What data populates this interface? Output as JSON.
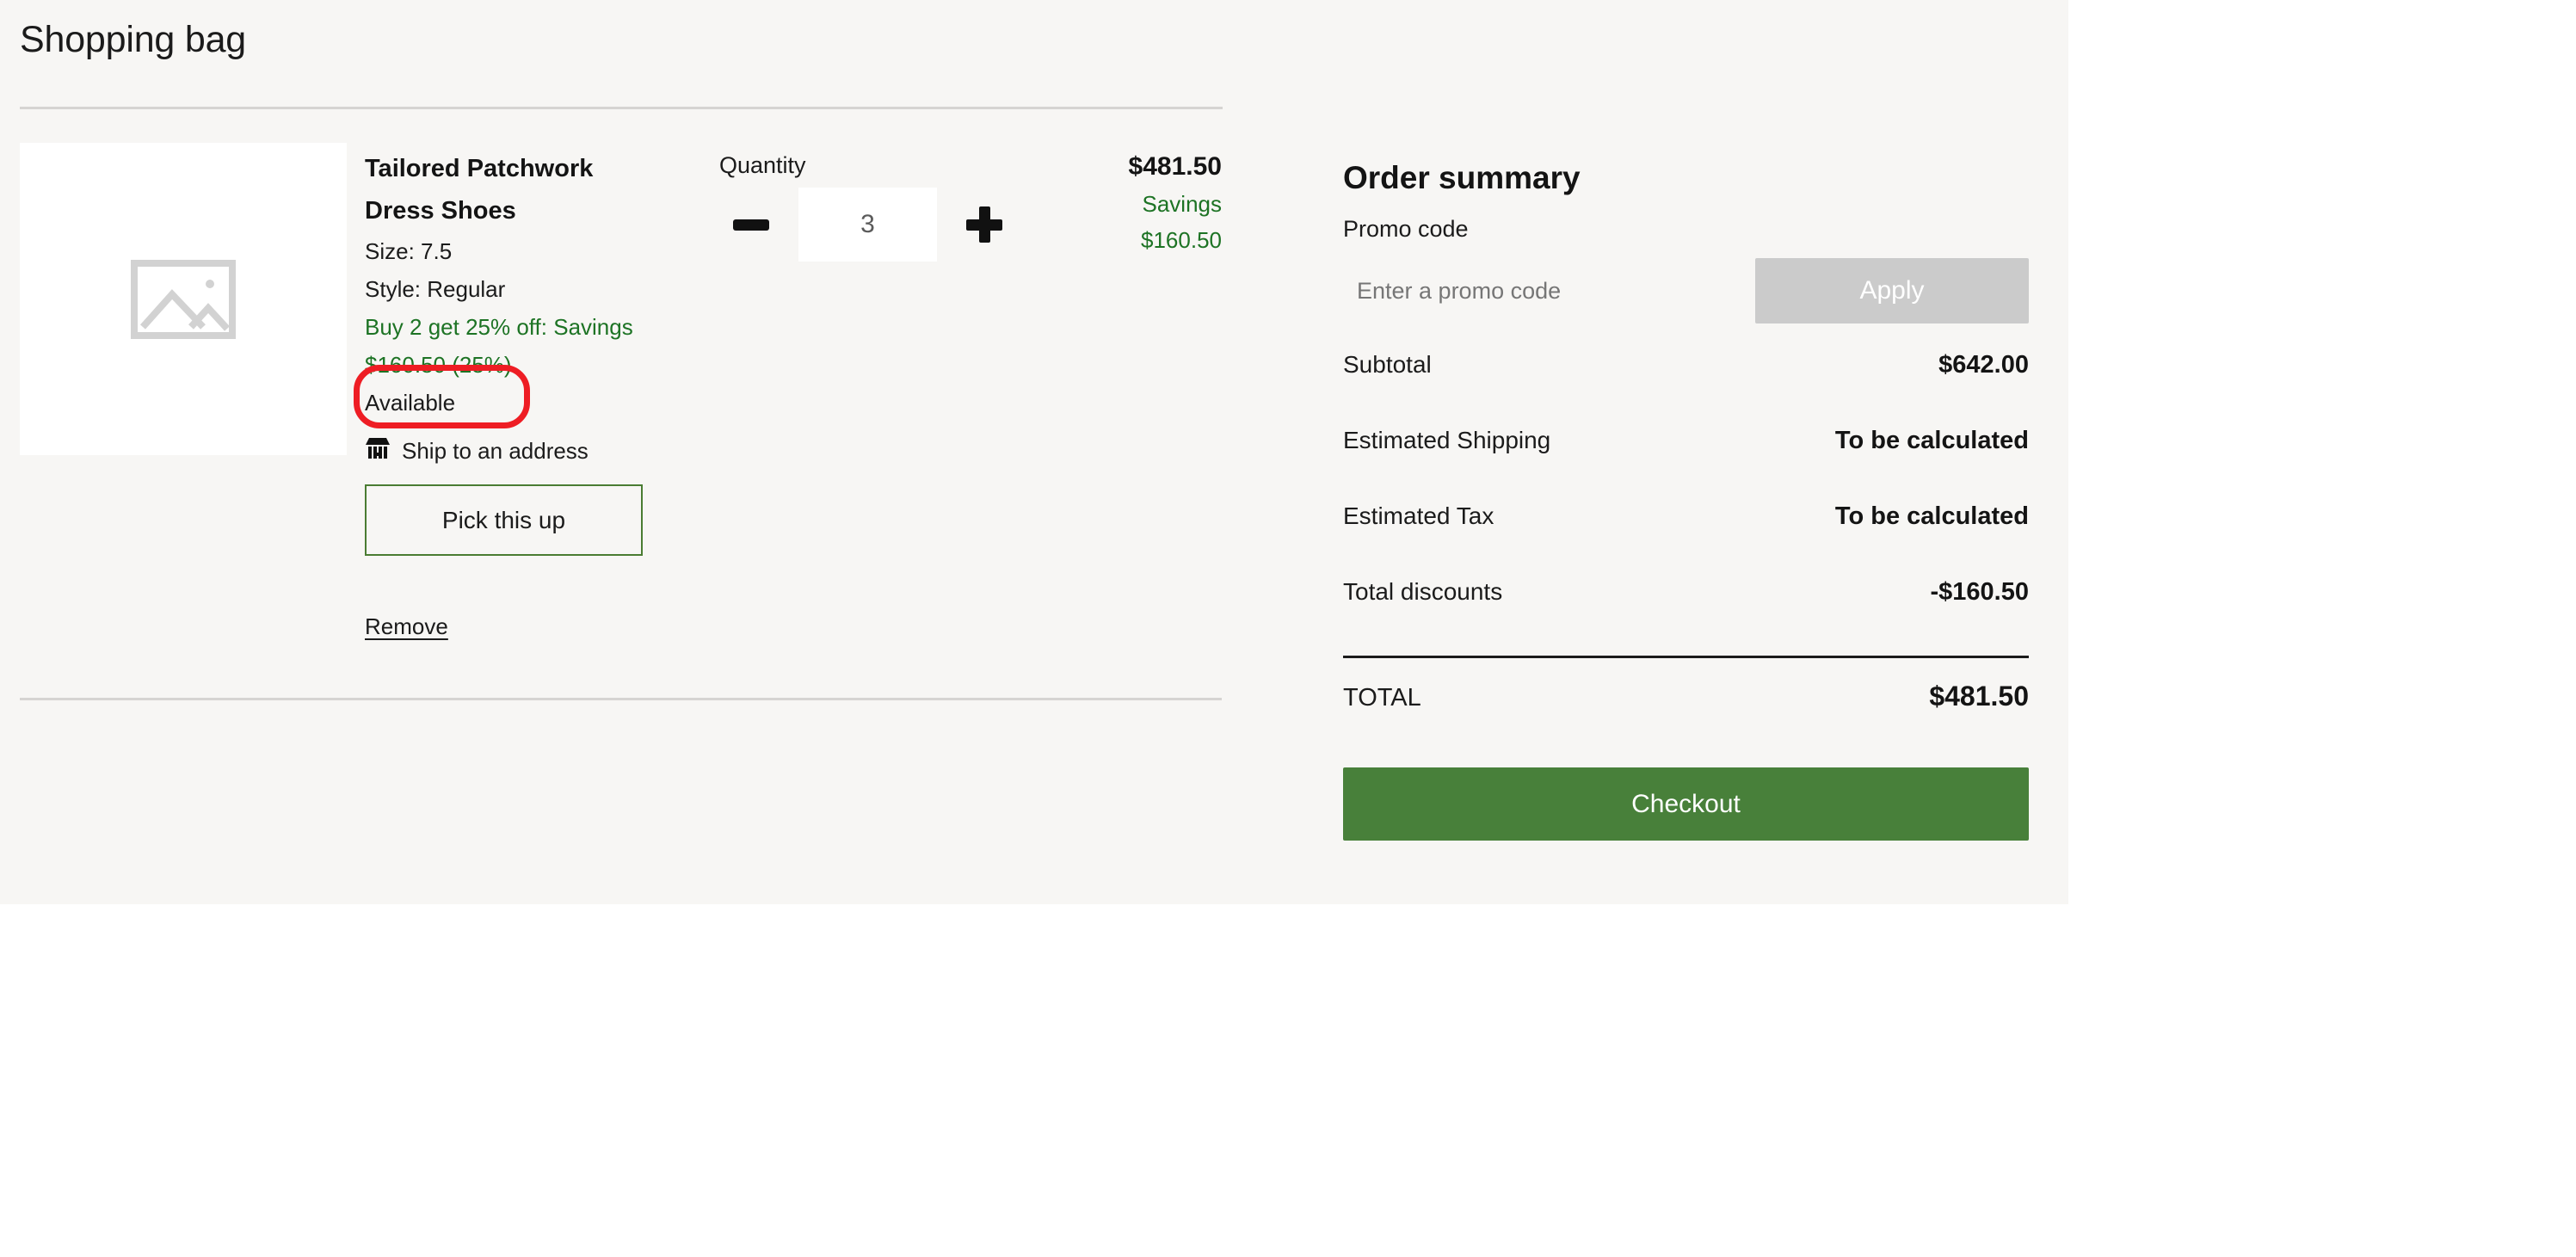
{
  "header": {
    "title": "Shopping bag"
  },
  "cart": {
    "item": {
      "image_placeholder_icon": "image-placeholder-icon",
      "title": "Tailored Patchwork Dress Shoes",
      "size": "Size: 7.5",
      "style": "Style: Regular",
      "promo_text": "Buy 2 get 25% off: Savings $160.50 (25%)",
      "availability": "Available",
      "fulfillment_icon": "storefront-icon",
      "fulfillment_label": "Ship to an address",
      "pickup_button": "Pick this up",
      "remove_link": "Remove",
      "quantity_label": "Quantity",
      "quantity_value": "3",
      "decrease_icon": "minus-icon",
      "increase_icon": "plus-icon",
      "line_price": "$481.50",
      "savings_label": "Savings",
      "savings_amount": "$160.50"
    }
  },
  "summary": {
    "title": "Order summary",
    "promo_label": "Promo code",
    "promo_placeholder": "Enter a promo code",
    "promo_value": "",
    "apply_button": "Apply",
    "rows": [
      {
        "label": "Subtotal",
        "value": "$642.00"
      },
      {
        "label": "Estimated Shipping",
        "value": "To be calculated"
      },
      {
        "label": "Estimated Tax",
        "value": "To be calculated"
      },
      {
        "label": "Total discounts",
        "value": "-$160.50"
      }
    ],
    "total_label": "TOTAL",
    "total_value": "$481.50",
    "checkout_button": "Checkout"
  },
  "colors": {
    "page_background": "#f7f6f4",
    "savings_green": "#1d7324",
    "checkout_green": "#48803a",
    "pickup_border_green": "#4a7c32",
    "apply_disabled": "#cbcbcb",
    "annotation_red": "#ee1d24"
  }
}
